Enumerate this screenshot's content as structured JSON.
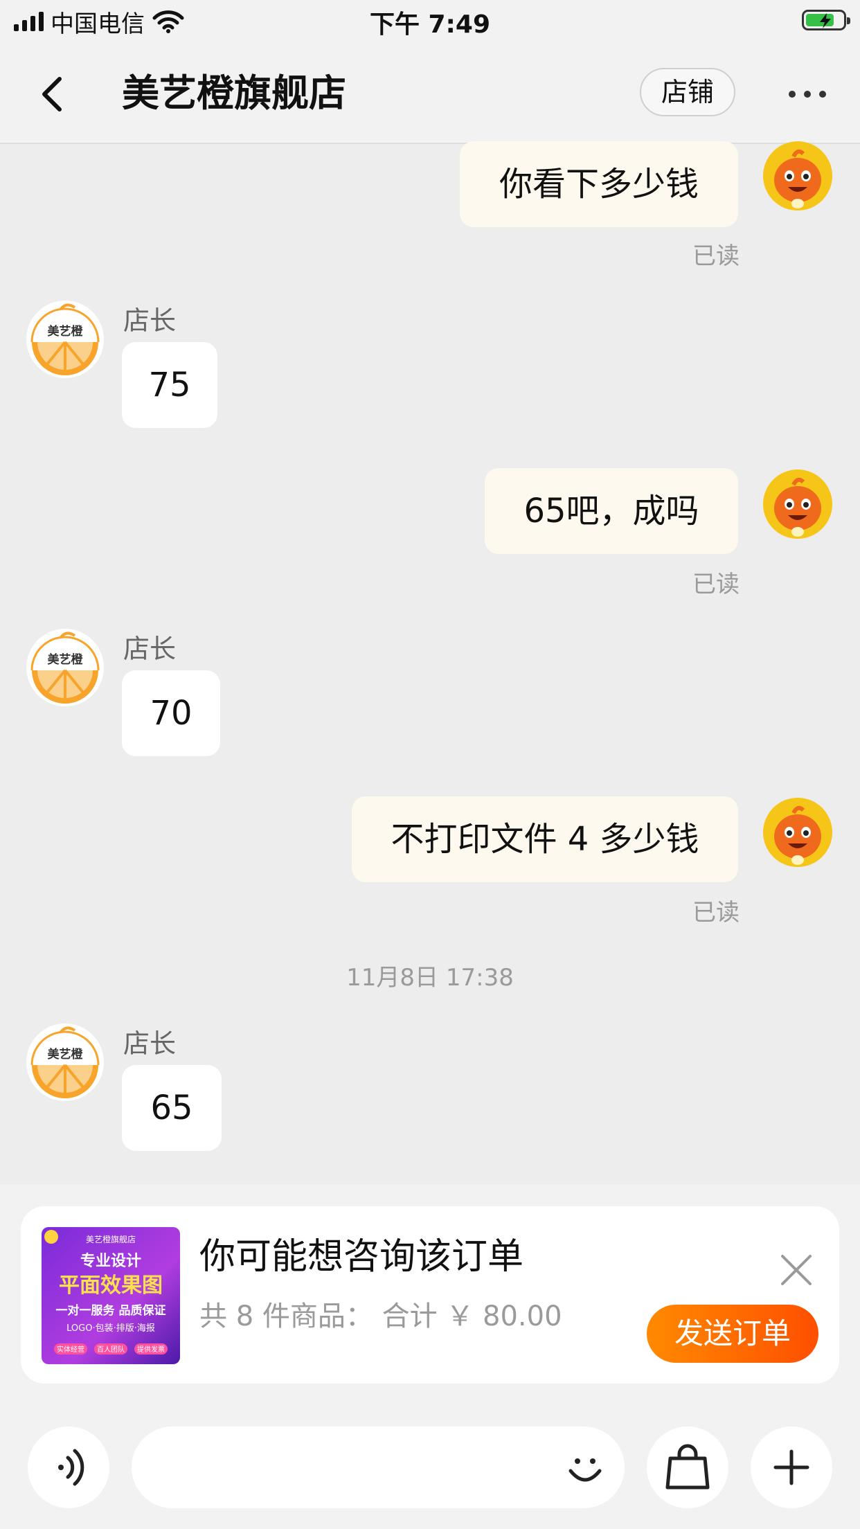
{
  "status_bar": {
    "carrier": "中国电信",
    "time": "下午 7:49"
  },
  "header": {
    "title": "美艺橙旗舰店",
    "store_button": "店铺"
  },
  "messages": [
    {
      "from": "me",
      "text": "你看下多少钱",
      "status": "已读"
    },
    {
      "from": "shop",
      "sender": "店长",
      "text": "75"
    },
    {
      "from": "me",
      "text": "65吧，成吗",
      "status": "已读"
    },
    {
      "from": "shop",
      "sender": "店长",
      "text": "70"
    },
    {
      "from": "me",
      "text": "不打印文件 4 多少钱",
      "status": "已读"
    },
    {
      "from": "shop",
      "sender": "店长",
      "text": "65"
    }
  ],
  "timestamp": "11月8日 17:38",
  "shop_avatar_text": "美艺橙",
  "order_card": {
    "title": "你可能想咨询该订单",
    "summary": "共 8 件商品： 合计 ￥ 80.00",
    "send_button": "发送订单",
    "thumbnail": {
      "shop": "美艺橙旗舰店",
      "line1": "专业设计",
      "line2": "平面效果图",
      "line3": "一对一服务 品质保证",
      "line4": "LOGO·包装·排版·海报",
      "tags": [
        "实体经营",
        "百人团队",
        "提供发票"
      ]
    }
  },
  "input_bar": {
    "placeholder": ""
  },
  "colors": {
    "background": "#ededed",
    "my_bubble": "#fdf9ee",
    "their_bubble": "#ffffff",
    "accent_orange": "#ff6a00"
  },
  "icons": [
    "back-icon",
    "more-icon",
    "voice-icon",
    "emoji-icon",
    "shopping-bag-icon",
    "plus-icon",
    "close-icon"
  ]
}
